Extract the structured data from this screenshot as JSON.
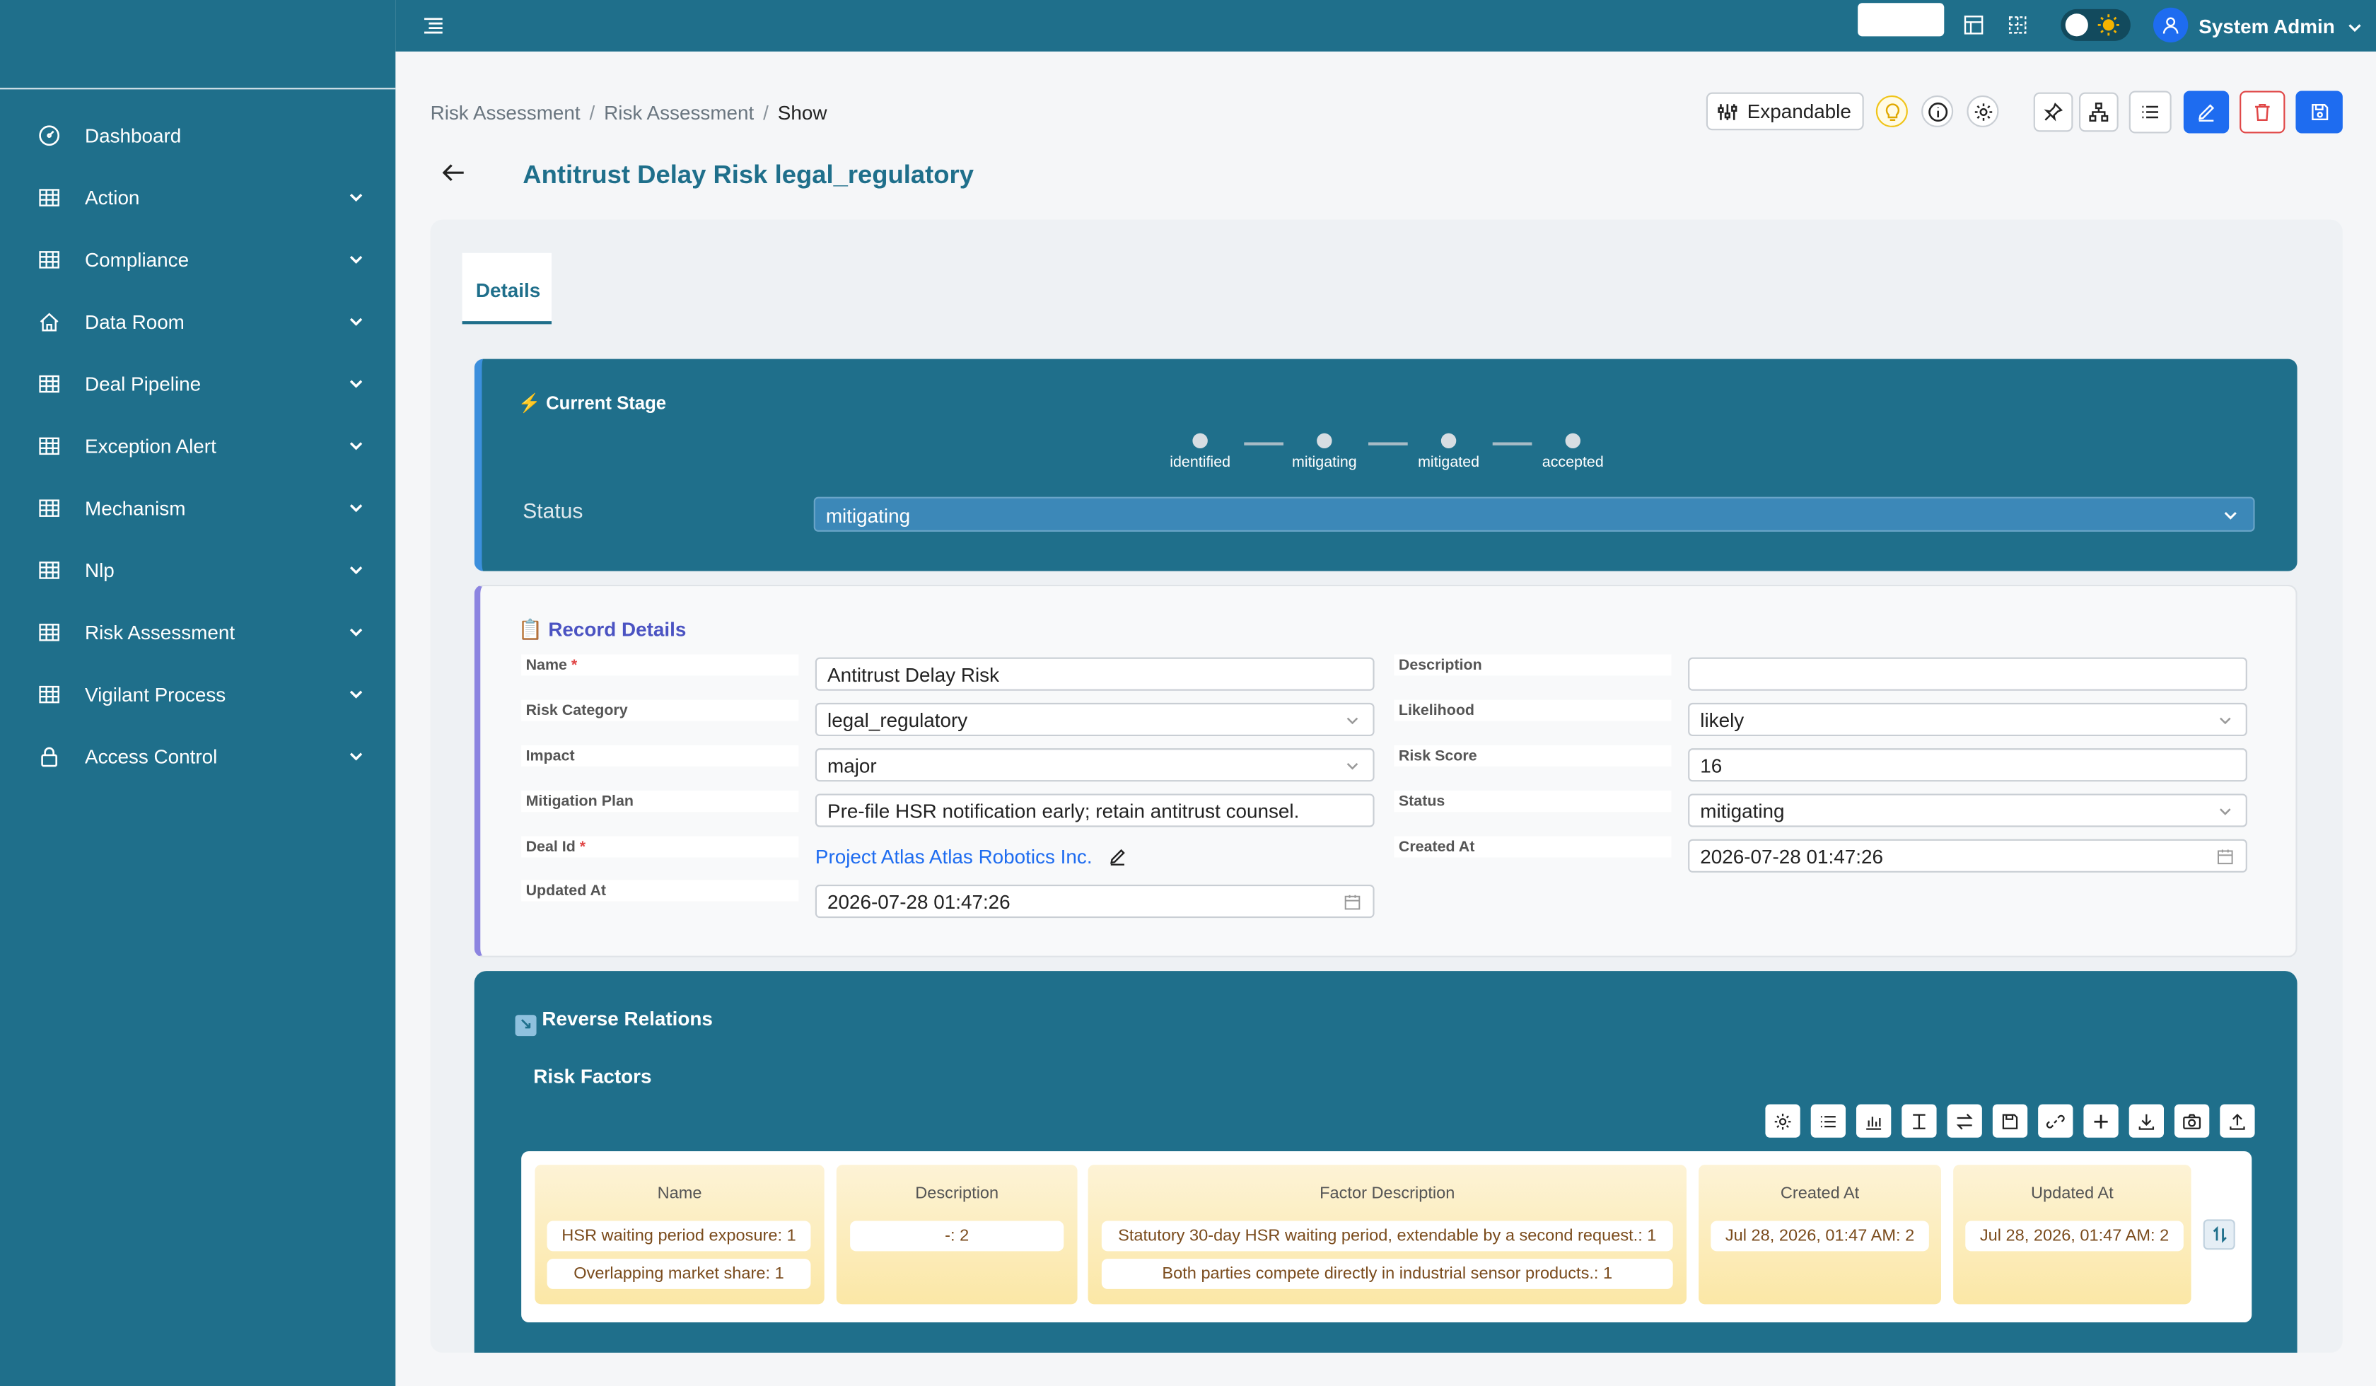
{
  "sidebar": {
    "items": [
      {
        "label": "Dashboard",
        "icon": "dashboard-icon",
        "has_children": false
      },
      {
        "label": "Action",
        "icon": "table-icon",
        "has_children": true
      },
      {
        "label": "Compliance",
        "icon": "table-icon",
        "has_children": true
      },
      {
        "label": "Data Room",
        "icon": "home-icon",
        "has_children": true
      },
      {
        "label": "Deal Pipeline",
        "icon": "table-icon",
        "has_children": true
      },
      {
        "label": "Exception Alert",
        "icon": "table-icon",
        "has_children": true
      },
      {
        "label": "Mechanism",
        "icon": "table-icon",
        "has_children": true
      },
      {
        "label": "Nlp",
        "icon": "table-icon",
        "has_children": true
      },
      {
        "label": "Risk Assessment",
        "icon": "table-icon",
        "has_children": true
      },
      {
        "label": "Vigilant Process",
        "icon": "table-icon",
        "has_children": true
      },
      {
        "label": "Access Control",
        "icon": "lock-icon",
        "has_children": true
      }
    ]
  },
  "topbar": {
    "user_name": "System Admin",
    "theme": "light"
  },
  "breadcrumb": {
    "items": [
      "Risk Assessment",
      "Risk Assessment"
    ],
    "current": "Show"
  },
  "toolbar": {
    "expand_label": "Expandable"
  },
  "page": {
    "title": "Antitrust Delay Risk legal_regulatory",
    "tabs": [
      {
        "label": "Details",
        "active": true
      }
    ]
  },
  "stage": {
    "title": "Current Stage",
    "steps": [
      "identified",
      "mitigating",
      "mitigated",
      "accepted"
    ],
    "status_label": "Status",
    "status_value": "mitigating"
  },
  "record": {
    "title": "Record Details",
    "left": [
      {
        "label": "Name",
        "required": true,
        "value": "Antitrust Delay Risk",
        "type": "text"
      },
      {
        "label": "Risk Category",
        "required": false,
        "value": "legal_regulatory",
        "type": "select"
      },
      {
        "label": "Impact",
        "required": false,
        "value": "major",
        "type": "select"
      },
      {
        "label": "Mitigation Plan",
        "required": false,
        "value": "Pre-file HSR notification early; retain antitrust counsel.",
        "type": "text"
      },
      {
        "label": "Deal Id",
        "required": true,
        "value": "Project Atlas Atlas Robotics Inc.",
        "type": "link"
      },
      {
        "label": "Updated At",
        "required": false,
        "value": "2026-07-28 01:47:26",
        "type": "date"
      }
    ],
    "right": [
      {
        "label": "Description",
        "required": false,
        "value": "",
        "type": "text"
      },
      {
        "label": "Likelihood",
        "required": false,
        "value": "likely",
        "type": "select"
      },
      {
        "label": "Risk Score",
        "required": false,
        "value": "16",
        "type": "text"
      },
      {
        "label": "Status",
        "required": false,
        "value": "mitigating",
        "type": "select"
      },
      {
        "label": "Created At",
        "required": false,
        "value": "2026-07-28 01:47:26",
        "type": "date"
      }
    ]
  },
  "relations": {
    "title": "Reverse Relations",
    "subtitle": "Risk Factors",
    "columns": [
      {
        "header": "Name",
        "chips": [
          "HSR waiting period exposure: 1",
          "Overlapping market share: 1"
        ]
      },
      {
        "header": "Description",
        "chips": [
          "-: 2"
        ]
      },
      {
        "header": "Factor Description",
        "chips": [
          "Statutory 30-day HSR waiting period, extendable by a second request.: 1",
          "Both parties compete directly in industrial sensor products.: 1"
        ]
      },
      {
        "header": "Created At",
        "chips": [
          "Jul 28, 2026, 01:47 AM: 2"
        ]
      },
      {
        "header": "Updated At",
        "chips": [
          "Jul 28, 2026, 01:47 AM: 2"
        ]
      }
    ]
  }
}
